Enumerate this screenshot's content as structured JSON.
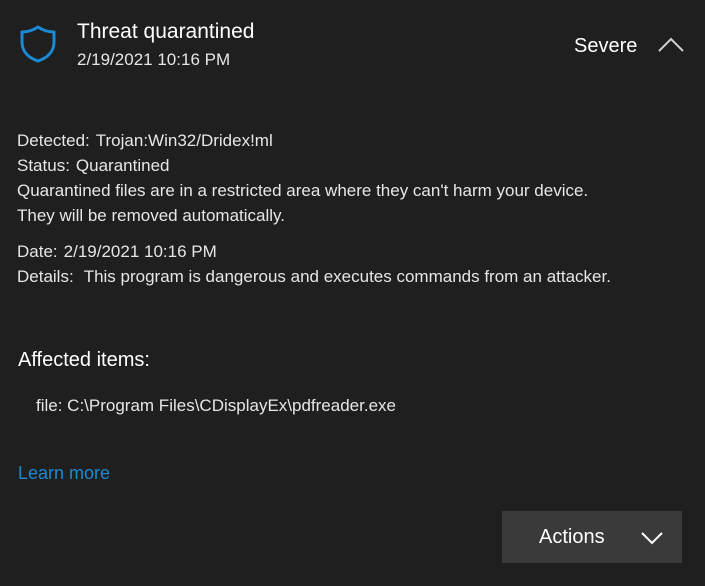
{
  "header": {
    "title": "Threat quarantined",
    "date": "2/19/2021 10:16 PM",
    "severity": "Severe",
    "shield_icon": "shield-icon",
    "collapse_icon": "chevron-up-icon"
  },
  "details": {
    "detected_label": "Detected:",
    "detected_value": "Trojan:Win32/Dridex!ml",
    "status_label": "Status:",
    "status_value": "Quarantined",
    "quarantine_note_line1": "Quarantined files are in a restricted area where they can't harm your device.",
    "quarantine_note_line2": "They will be removed automatically.",
    "date_label": "Date:",
    "date_value": "2/19/2021 10:16 PM",
    "details_label": "Details:",
    "details_value": "This program is dangerous and executes commands from an attacker."
  },
  "affected": {
    "heading": "Affected items:",
    "items": [
      "file: C:\\Program Files\\CDisplayEx\\pdfreader.exe"
    ]
  },
  "links": {
    "learn_more": "Learn more"
  },
  "actions": {
    "label": "Actions",
    "icon": "chevron-down-icon"
  },
  "colors": {
    "background": "#1f1f1f",
    "accent": "#0078d4",
    "link": "#1a8ad4",
    "button": "#3a3a3a"
  }
}
